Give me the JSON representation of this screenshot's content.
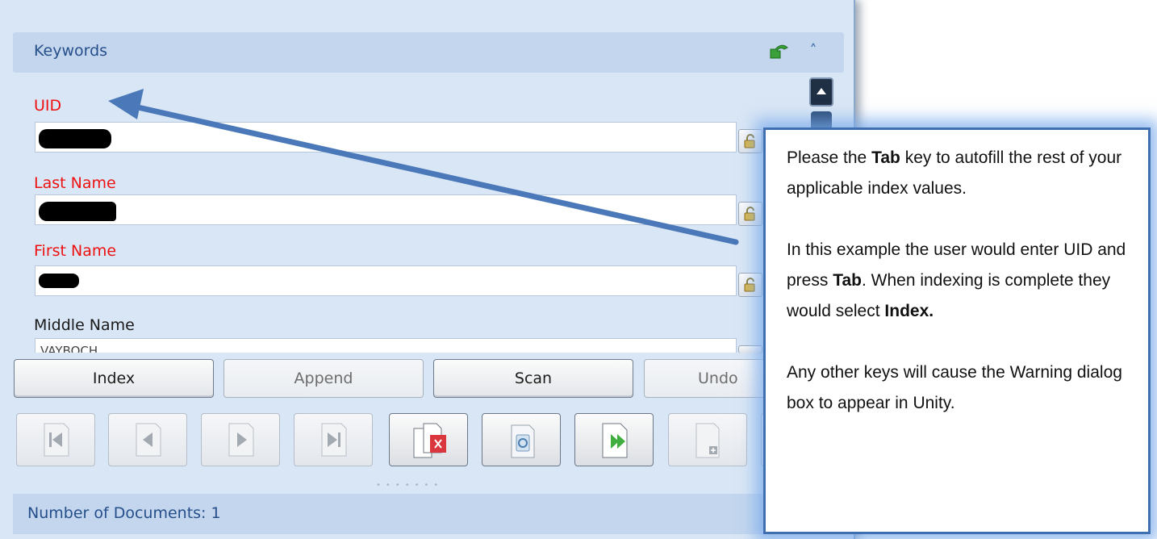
{
  "keywords_panel": {
    "title": "Keywords"
  },
  "fields": [
    {
      "label": "UID",
      "required": true
    },
    {
      "label": "Last Name",
      "required": true
    },
    {
      "label": "First Name",
      "required": true
    },
    {
      "label": "Middle Name",
      "required": false,
      "value": "VAYBOCH"
    }
  ],
  "buttons": {
    "index": "Index",
    "append": "Append",
    "scan": "Scan",
    "undo": "Undo"
  },
  "toolbar_icons": [
    "first-page-icon",
    "previous-page-icon",
    "next-page-icon",
    "last-page-icon",
    "delete-document-icon",
    "recycle-icon",
    "forward-document-icon",
    "add-page-icon"
  ],
  "footer": {
    "documents_label": "Number of Documents: 1"
  },
  "callout": {
    "p1_a": "Please the ",
    "p1_b": "Tab",
    "p1_c": " key to autofill the rest of your applicable index values.",
    "p2_a": "In this example the user would enter UID and press ",
    "p2_b": "Tab",
    "p2_c": ".  When indexing is complete they would select ",
    "p2_d": "Index.",
    "p3": "Any other keys will cause the Warning dialog box to appear in Unity."
  },
  "colors": {
    "panel_bg": "#d9e6f5",
    "header_bg": "#c3d6ee",
    "required_label": "#ee1111",
    "arrow": "#4a78b8",
    "callout_border": "#3f6fb0"
  }
}
